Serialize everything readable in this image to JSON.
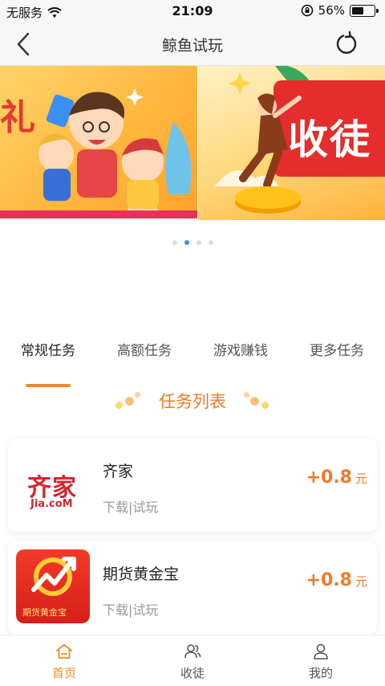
{
  "status_bar": {
    "carrier": "无服务",
    "time": "21:09",
    "battery": "56%",
    "battery_level": 0.56,
    "icons": [
      "wifi-icon",
      "orientation-lock-icon",
      "battery-icon"
    ]
  },
  "nav": {
    "title": "鲸鱼试玩",
    "back_icon": "chevron-left-icon",
    "refresh_icon": "refresh-icon"
  },
  "banner": {
    "slides": [
      {
        "text": "礼"
      },
      {
        "text": "收徒"
      }
    ],
    "dots_count": 4,
    "active_dot": 1,
    "accent": "#3a8ee6"
  },
  "tabs": [
    {
      "label": "常规任务",
      "active": true
    },
    {
      "label": "高额任务",
      "active": false
    },
    {
      "label": "游戏赚钱",
      "active": false
    },
    {
      "label": "更多任务",
      "active": false
    }
  ],
  "section_title": "任务列表",
  "tasks": [
    {
      "name": "齐家",
      "desc": "下载|试玩",
      "reward": "+0.8",
      "unit": "元",
      "logo_text": "齐家",
      "logo_sub": "Jia.coM"
    },
    {
      "name": "期货黄金宝",
      "desc": "下载|试玩",
      "reward": "+0.8",
      "unit": "元",
      "logo_text": "期货黄金宝"
    }
  ],
  "tabbar": [
    {
      "label": "首页",
      "icon": "home-icon",
      "active": true
    },
    {
      "label": "收徒",
      "icon": "users-icon",
      "active": false
    },
    {
      "label": "我的",
      "icon": "user-icon",
      "active": false
    }
  ],
  "colors": {
    "accent": "#f08a24",
    "reward": "#f07a2a"
  }
}
